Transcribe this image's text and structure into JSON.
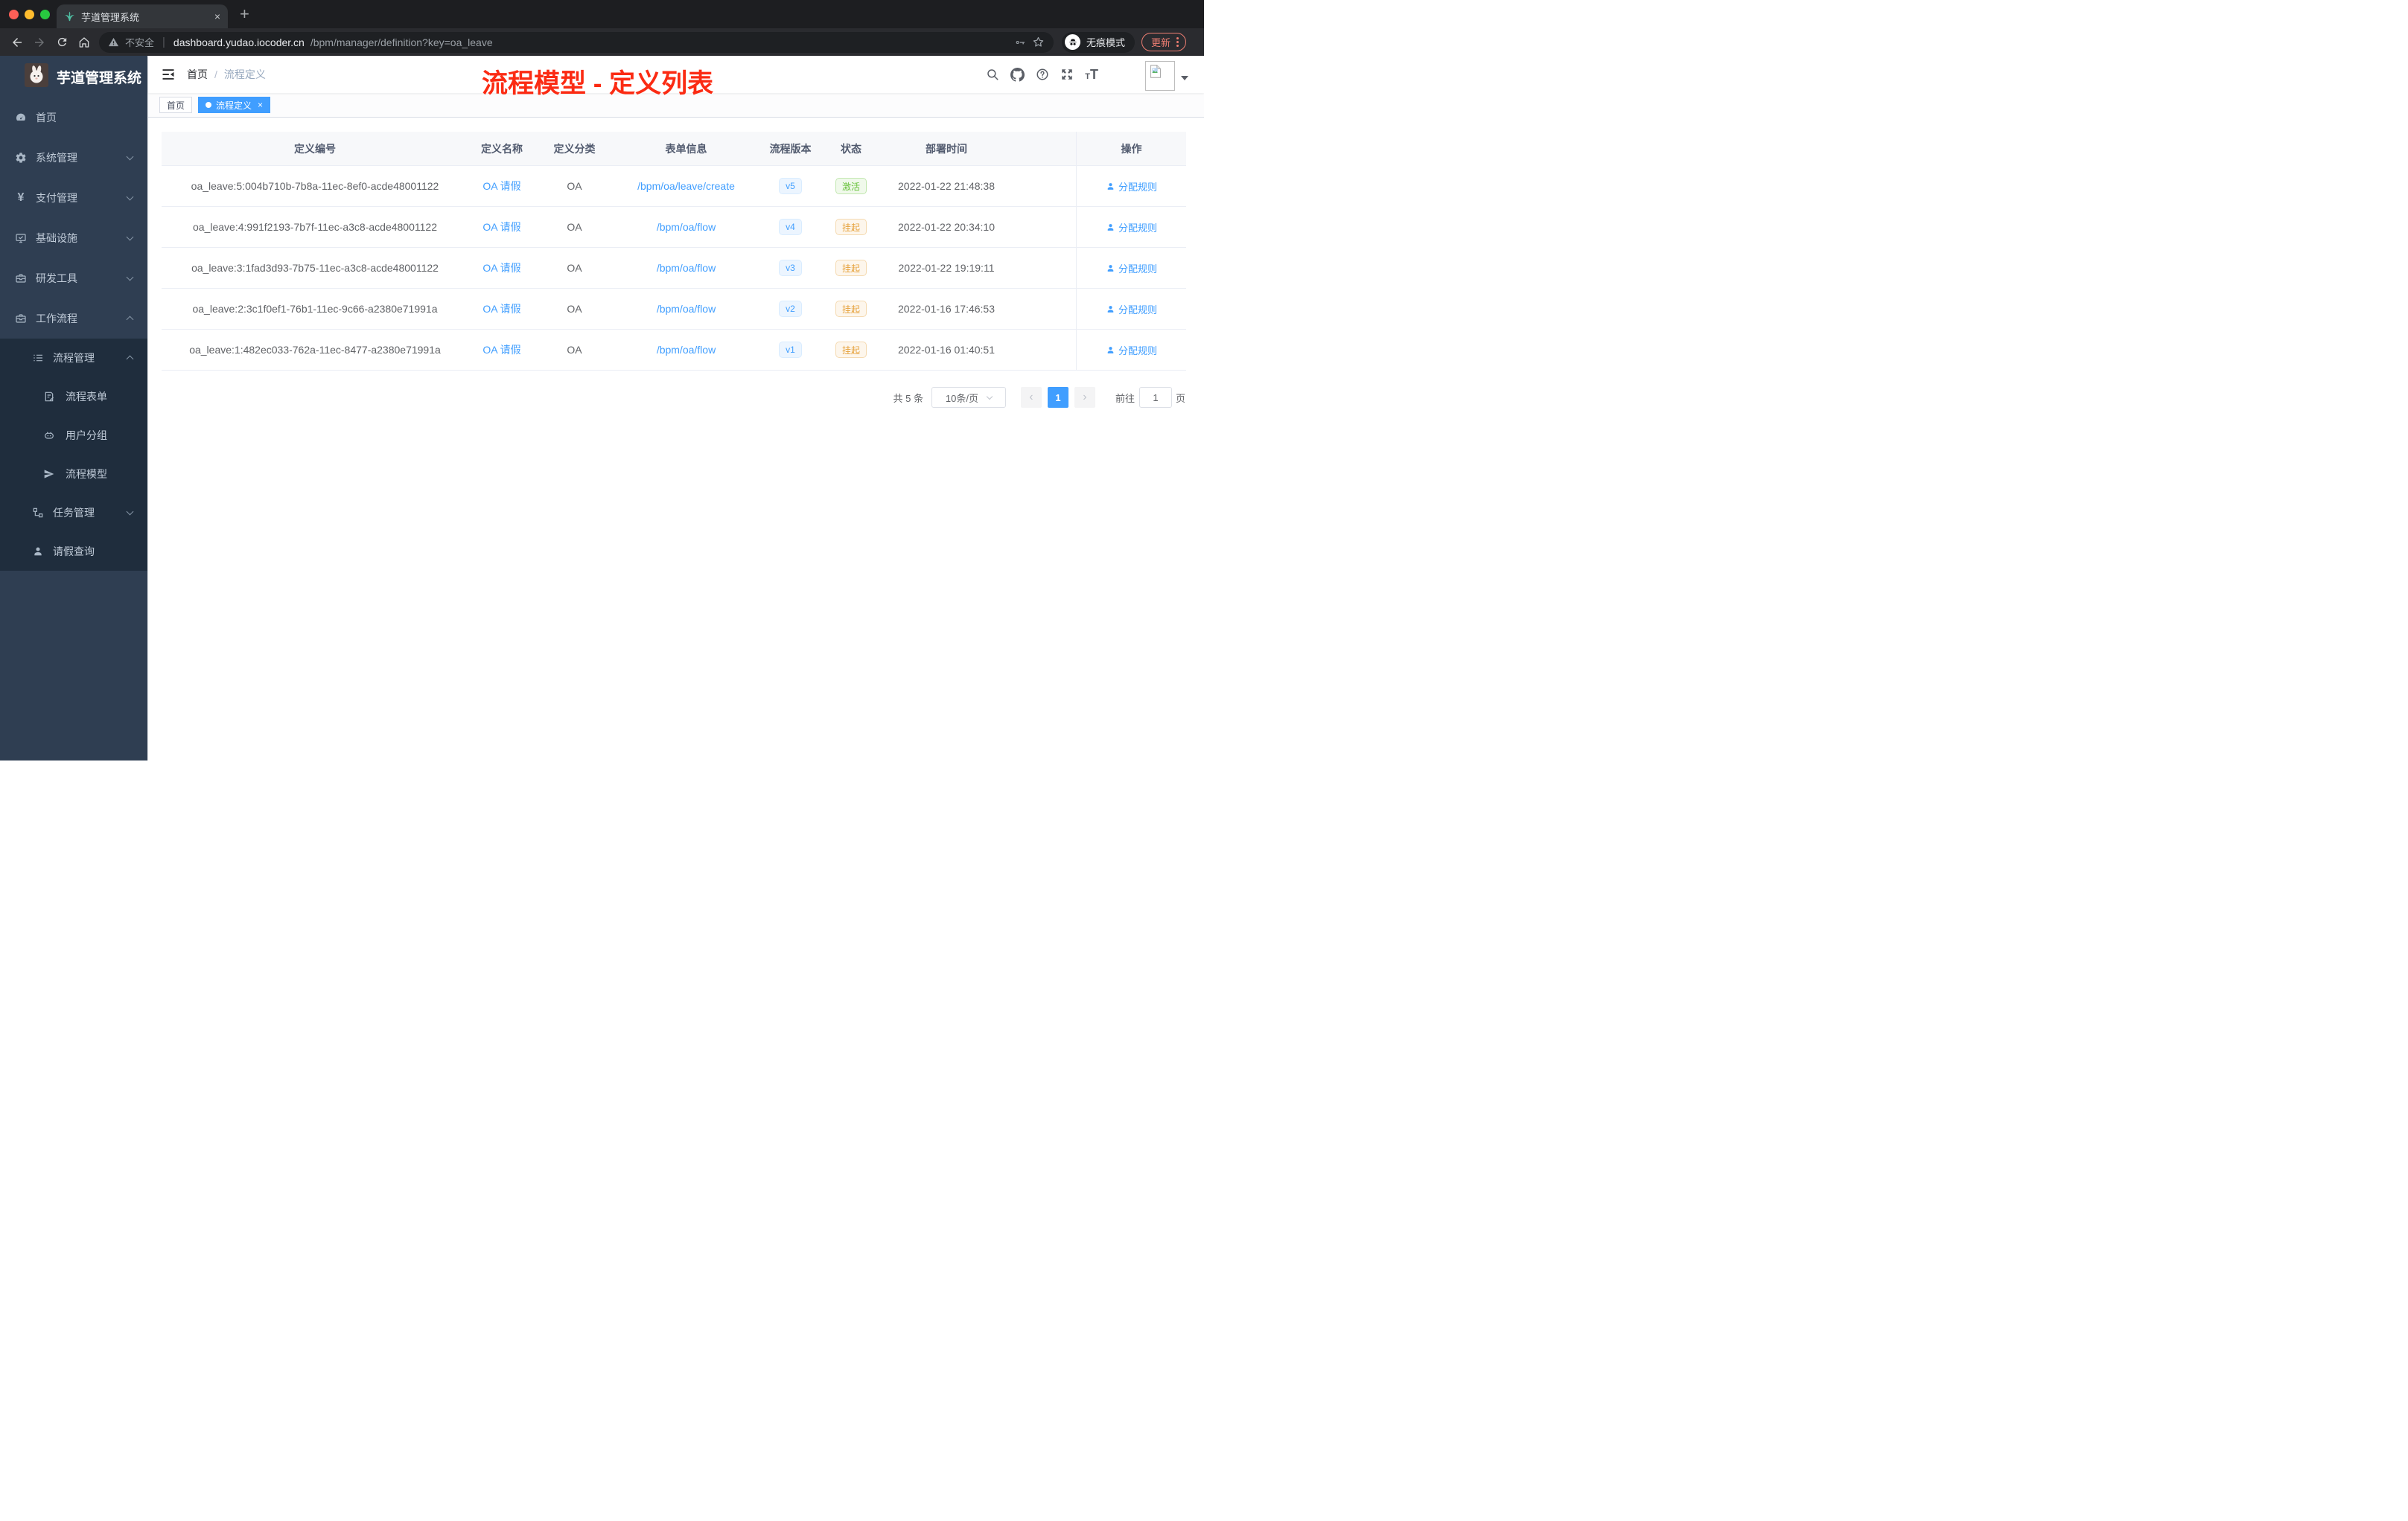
{
  "browser": {
    "tab_title": "芋道管理系统",
    "tab_close": "×",
    "new_tab": "+",
    "security_label": "不安全",
    "url_host": "dashboard.yudao.iocoder.cn",
    "url_path": "/bpm/manager/definition?key=oa_leave",
    "incognito_label": "无痕模式",
    "update_label": "更新"
  },
  "sidebar": {
    "title": "芋道管理系统",
    "menu": [
      {
        "label": "首页",
        "icon": "dashboard-icon"
      },
      {
        "label": "系统管理",
        "icon": "gear-icon",
        "arrow": "down"
      },
      {
        "label": "支付管理",
        "icon": "yen-icon",
        "arrow": "down"
      },
      {
        "label": "基础设施",
        "icon": "monitor-icon",
        "arrow": "down"
      },
      {
        "label": "研发工具",
        "icon": "toolbox-icon",
        "arrow": "down"
      },
      {
        "label": "工作流程",
        "icon": "toolbox-icon",
        "arrow": "up"
      }
    ],
    "submenu": [
      {
        "label": "流程管理",
        "icon": "list-icon",
        "arrow": "up",
        "level": 1
      },
      {
        "label": "流程表单",
        "icon": "form-icon",
        "level": 2
      },
      {
        "label": "用户分组",
        "icon": "robot-icon",
        "level": 2
      },
      {
        "label": "流程模型",
        "icon": "plane-icon",
        "level": 2
      },
      {
        "label": "任务管理",
        "icon": "tree-icon",
        "arrow": "down",
        "level": 1
      },
      {
        "label": "请假查询",
        "icon": "person-icon",
        "level": 1
      }
    ]
  },
  "header": {
    "breadcrumb": [
      "首页",
      "流程定义"
    ],
    "breadcrumb_separator": "/"
  },
  "annotation": {
    "text": "流程模型 - 定义列表",
    "color": "#fb2b13"
  },
  "tags": [
    {
      "label": "首页",
      "active": false,
      "closable": false
    },
    {
      "label": "流程定义",
      "active": true,
      "closable": true
    }
  ],
  "table": {
    "columns": [
      "定义编号",
      "定义名称",
      "定义分类",
      "表单信息",
      "流程版本",
      "状态",
      "部署时间",
      "操作"
    ],
    "rows": [
      {
        "id": "oa_leave:5:004b710b-7b8a-11ec-8ef0-acde48001122",
        "name": "OA 请假",
        "category": "OA",
        "form": "/bpm/oa/leave/create",
        "version": "v5",
        "status": "激活",
        "status_type": "success",
        "deploy_time": "2022-01-22 21:48:38",
        "action": "分配规则"
      },
      {
        "id": "oa_leave:4:991f2193-7b7f-11ec-a3c8-acde48001122",
        "name": "OA 请假",
        "category": "OA",
        "form": "/bpm/oa/flow",
        "version": "v4",
        "status": "挂起",
        "status_type": "warning",
        "deploy_time": "2022-01-22 20:34:10",
        "action": "分配规则"
      },
      {
        "id": "oa_leave:3:1fad3d93-7b75-11ec-a3c8-acde48001122",
        "name": "OA 请假",
        "category": "OA",
        "form": "/bpm/oa/flow",
        "version": "v3",
        "status": "挂起",
        "status_type": "warning",
        "deploy_time": "2022-01-22 19:19:11",
        "action": "分配规则"
      },
      {
        "id": "oa_leave:2:3c1f0ef1-76b1-11ec-9c66-a2380e71991a",
        "name": "OA 请假",
        "category": "OA",
        "form": "/bpm/oa/flow",
        "version": "v2",
        "status": "挂起",
        "status_type": "warning",
        "deploy_time": "2022-01-16 17:46:53",
        "action": "分配规则"
      },
      {
        "id": "oa_leave:1:482ec033-762a-11ec-8477-a2380e71991a",
        "name": "OA 请假",
        "category": "OA",
        "form": "/bpm/oa/flow",
        "version": "v1",
        "status": "挂起",
        "status_type": "warning",
        "deploy_time": "2022-01-16 01:40:51",
        "action": "分配规则"
      }
    ]
  },
  "pagination": {
    "total": "共 5 条",
    "page_size": "10条/页",
    "prev": "‹",
    "next": "›",
    "current_page": "1",
    "goto_label": "前往",
    "goto_value": "1",
    "page_unit": "页"
  },
  "colors": {
    "accent": "#409eff",
    "success_text": "#67c23a",
    "warning_text": "#e6a23c",
    "sidebar_bg": "#2f3e52",
    "submenu_bg": "#1f2d3d",
    "annotation_red": "#fb2b13",
    "update_pill": "#ee7e72"
  }
}
